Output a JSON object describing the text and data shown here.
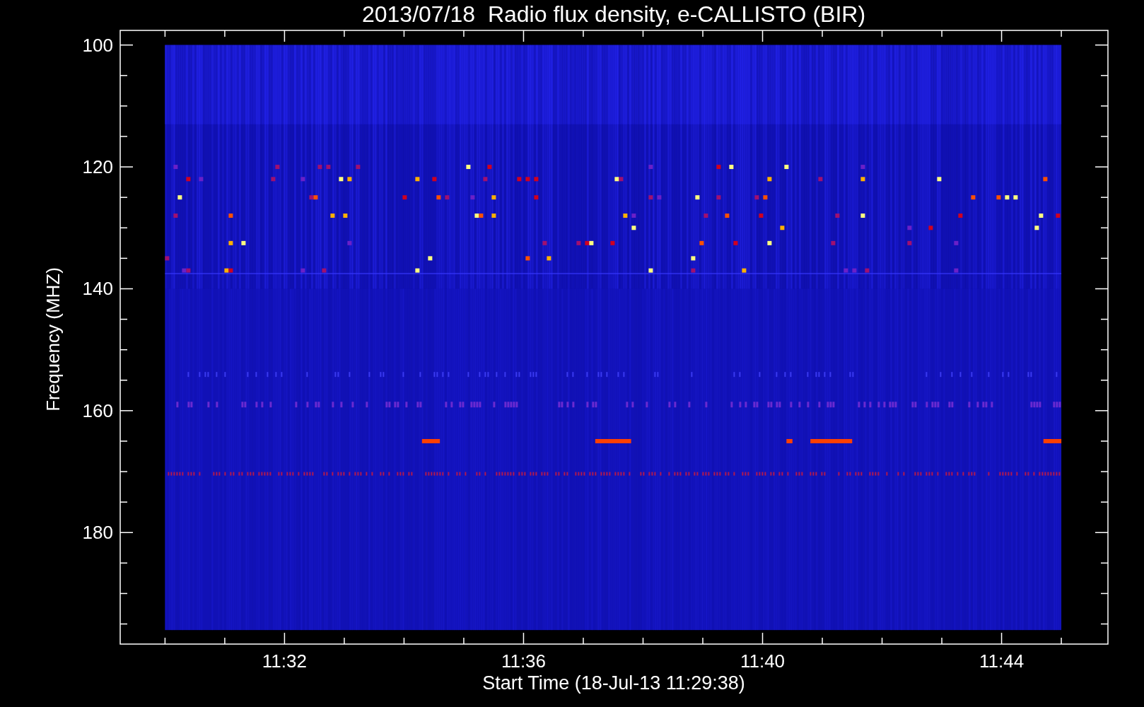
{
  "plot": {
    "title": "2013/07/18  Radio flux density, e-CALLISTO (BIR)",
    "ylabel": "Frequency (MHZ)",
    "xlabel": "Start Time (18-Jul-13 11:29:38)",
    "y_tick_labels": [
      "100",
      "120",
      "140",
      "160",
      "180"
    ],
    "x_tick_labels": [
      "11:32",
      "11:36",
      "11:40",
      "11:44"
    ]
  }
}
